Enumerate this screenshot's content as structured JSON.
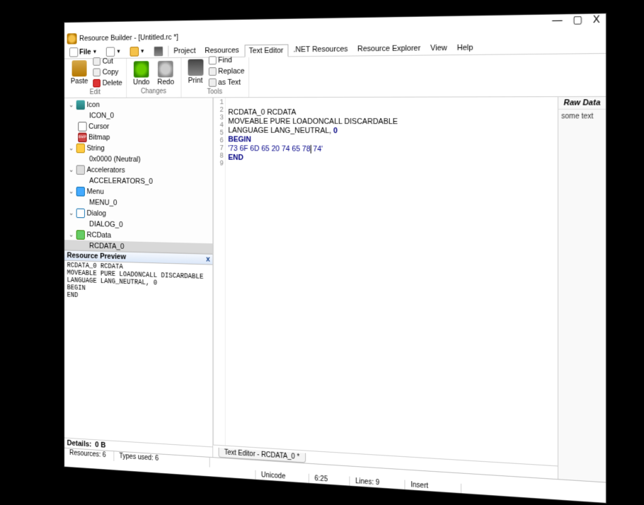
{
  "title": "Resource Builder - [Untitled.rc *]",
  "menu": {
    "file": "File",
    "project": "Project",
    "resources": "Resources",
    "text_editor": "Text Editor",
    "net_resources": ".NET Resources",
    "resource_explorer": "Resource Explorer",
    "view": "View",
    "help": "Help"
  },
  "ribbon": {
    "paste": "Paste",
    "cut": "Cut",
    "copy": "Copy",
    "delete": "Delete",
    "edit": "Edit",
    "undo": "Undo",
    "redo": "Redo",
    "changes": "Changes",
    "print": "Print",
    "find": "Find",
    "replace": "Replace",
    "as_text": "as Text",
    "tools": "Tools"
  },
  "tree": {
    "icon": "Icon",
    "icon_0": "ICON_0",
    "cursor": "Cursor",
    "bitmap": "Bitmap",
    "string": "String",
    "neutral": "0x0000 (Neutral)",
    "accelerators": "Accelerators",
    "accelerators_0": "ACCELERATORS_0",
    "menu": "Menu",
    "menu_0": "MENU_0",
    "dialog": "Dialog",
    "dialog_0": "DIALOG_0",
    "rcdata": "RCData",
    "rcdata_0": "RCDATA_0"
  },
  "preview": {
    "header": "Resource Preview",
    "body": "RCDATA_0 RCDATA\nMOVEABLE PURE LOADONCALL DISCARDABLE\nLANGUAGE LANG_NEUTRAL, 0\nBEGIN\nEND"
  },
  "details": {
    "label": "Details:",
    "value": "0 B"
  },
  "editor": {
    "lines": [
      "1",
      "2",
      "3",
      "4",
      "5",
      "6",
      "7",
      "8",
      "9"
    ],
    "l2": "RCDATA_0 RCDATA",
    "l3": "MOVEABLE PURE LOADONCALL DISCARDABLE",
    "l4a": "LANGUAGE LANG_NEUTRAL, ",
    "l4b": "0",
    "l5": "BEGIN",
    "l6a": "'73 6F 6D 65 20 74 65 78",
    "l6b": " 74'",
    "l7": "END",
    "tab": "Text Editor - RCDATA_0 *"
  },
  "right": {
    "header": "Raw Data",
    "body": "some text"
  },
  "status": {
    "resources": "Resources: 6",
    "types": "Types used: 6",
    "encoding": "Unicode",
    "pos": "6:25",
    "lines": "Lines: 9",
    "mode": "Insert"
  }
}
